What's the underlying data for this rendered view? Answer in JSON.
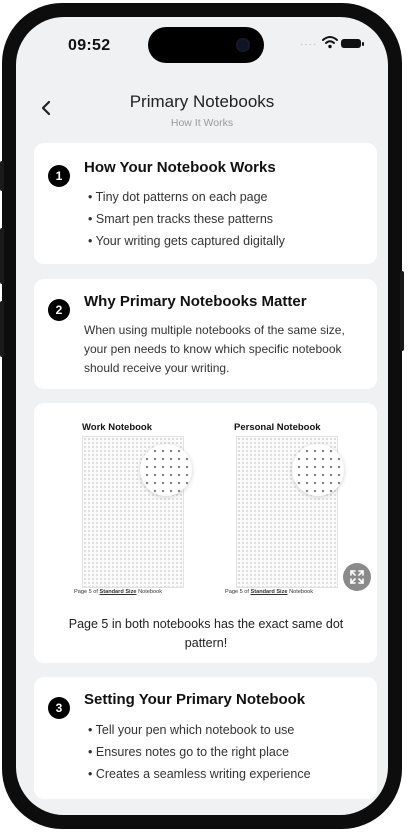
{
  "status_bar": {
    "time": "09:52",
    "signal_dots": "····"
  },
  "header": {
    "title": "Primary Notebooks",
    "subtitle": "How It Works"
  },
  "section1": {
    "number": "1",
    "title": "How Your Notebook Works",
    "bullets": [
      "Tiny dot patterns on each page",
      "Smart pen tracks these patterns",
      "Your writing gets captured digitally"
    ]
  },
  "section2": {
    "number": "2",
    "title": "Why Primary Notebooks Matter",
    "body": "When using multiple notebooks of the same size, your pen needs to know which specific notebook should receive your writing."
  },
  "illustration": {
    "work_label": "Work Notebook",
    "personal_label": "Personal Notebook",
    "page_prefix": "Page 5",
    "of_text": " of ",
    "size_text": "Standard Size",
    "notebook_word": " Notebook",
    "caption": "Page 5 in both notebooks has the exact same dot pattern!"
  },
  "section3": {
    "number": "3",
    "title": "Setting Your Primary Notebook",
    "bullets": [
      "Tell your pen which notebook to use",
      "Ensures notes go to the right place",
      "Creates a seamless writing experience"
    ]
  },
  "icons": {
    "back": "chevron-left-icon",
    "wifi": "wifi-icon",
    "battery": "battery-icon",
    "expand": "expand-icon"
  },
  "colors": {
    "background": "#eff1f3",
    "card": "#ffffff",
    "badge": "#000000"
  }
}
